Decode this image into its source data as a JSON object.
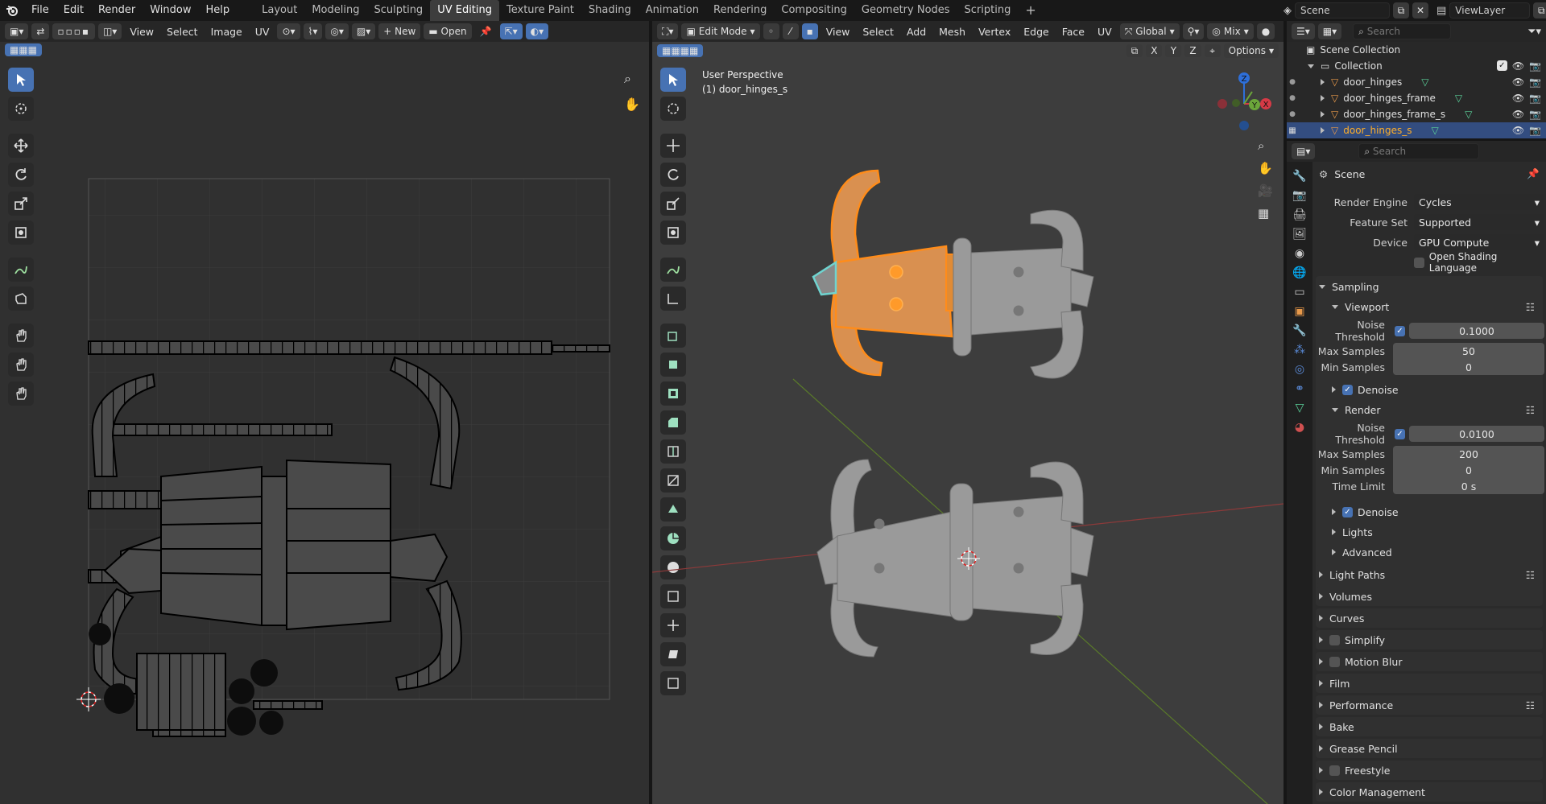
{
  "topbar": {
    "menus": [
      "File",
      "Edit",
      "Render",
      "Window",
      "Help"
    ],
    "workspaces": [
      "Layout",
      "Modeling",
      "Sculpting",
      "UV Editing",
      "Texture Paint",
      "Shading",
      "Animation",
      "Rendering",
      "Compositing",
      "Geometry Nodes",
      "Scripting"
    ],
    "active_workspace": "UV Editing",
    "scene_name": "Scene",
    "view_layer": "ViewLayer"
  },
  "uv_editor": {
    "menus": [
      "View",
      "Select",
      "Image",
      "UV"
    ],
    "new_label": "New",
    "open_label": "Open"
  },
  "viewport": {
    "mode": "Edit Mode",
    "menus": [
      "View",
      "Select",
      "Add",
      "Mesh",
      "Vertex",
      "Edge",
      "Face",
      "UV"
    ],
    "transform_orientation": "Global",
    "proportional": "Mix",
    "overlay_title": "User Perspective",
    "overlay_object": "(1) door_hinges_s",
    "axes": [
      "X",
      "Y",
      "Z"
    ],
    "options_label": "Options",
    "gizmo": {
      "x": "X",
      "y": "Y",
      "z": "Z"
    }
  },
  "outliner": {
    "search_placeholder": "Search",
    "scene_collection": "Scene Collection",
    "collection": "Collection",
    "objects": [
      "door_hinges",
      "door_hinges_frame",
      "door_hinges_frame_s",
      "door_hinges_s"
    ],
    "selected_index": 3
  },
  "properties": {
    "search_placeholder": "Search",
    "context": "Scene",
    "render_engine_label": "Render Engine",
    "render_engine": "Cycles",
    "feature_set_label": "Feature Set",
    "feature_set": "Supported",
    "device_label": "Device",
    "device": "GPU Compute",
    "osl_label": "Open Shading Language",
    "sampling": "Sampling",
    "viewport": "Viewport",
    "vp_noise_label": "Noise Threshold",
    "vp_noise": "0.1000",
    "vp_max_label": "Max Samples",
    "vp_max": "50",
    "vp_min_label": "Min Samples",
    "vp_min": "0",
    "denoise": "Denoise",
    "render": "Render",
    "r_noise_label": "Noise Threshold",
    "r_noise": "0.0100",
    "r_max_label": "Max Samples",
    "r_max": "200",
    "r_min_label": "Min Samples",
    "r_min": "0",
    "time_limit_label": "Time Limit",
    "time_limit": "0 s",
    "lights": "Lights",
    "advanced": "Advanced",
    "panels": [
      "Light Paths",
      "Volumes",
      "Curves",
      "Simplify",
      "Motion Blur",
      "Film",
      "Performance",
      "Bake",
      "Grease Pencil",
      "Freestyle",
      "Color Management"
    ]
  },
  "colors": {
    "accent": "#4772b3",
    "selection": "#ff8c1a",
    "background": "#303030"
  }
}
